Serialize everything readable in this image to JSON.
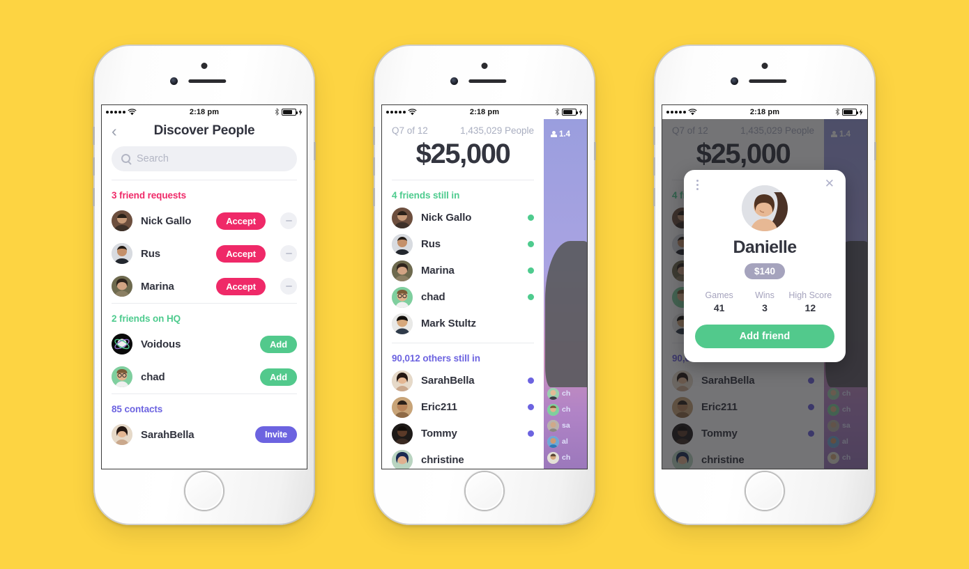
{
  "background_color": "#FDD442",
  "status_bar": {
    "time": "2:18 pm",
    "carrier_dots": 5
  },
  "colors": {
    "pink": "#ef2968",
    "green": "#4ecb8e",
    "purple": "#6c63e0",
    "text_dark": "#30323d",
    "muted": "#a9aec0"
  },
  "phone1": {
    "nav": {
      "back_icon": "chevron-left-icon",
      "title": "Discover People"
    },
    "search": {
      "placeholder": "Search",
      "value": ""
    },
    "sections": [
      {
        "label": "3 friend requests",
        "color": "pink",
        "rows": [
          {
            "name": "Nick Gallo",
            "action": "Accept",
            "dismiss": true
          },
          {
            "name": "Rus",
            "action": "Accept",
            "dismiss": true
          },
          {
            "name": "Marina",
            "action": "Accept",
            "dismiss": true
          }
        ]
      },
      {
        "label": "2 friends on HQ",
        "color": "green",
        "rows": [
          {
            "name": "Voidous",
            "action": "Add",
            "dismiss": false
          },
          {
            "name": "chad",
            "action": "Add",
            "dismiss": false
          }
        ]
      },
      {
        "label": "85 contacts",
        "color": "purple",
        "rows": [
          {
            "name": "SarahBella",
            "action": "Invite",
            "dismiss": false
          }
        ]
      }
    ]
  },
  "phone2": {
    "header": {
      "question": "Q7 of 12",
      "people": "1,435,029 People"
    },
    "prize": "$25,000",
    "sections": [
      {
        "label": "4 friends still in",
        "color": "green",
        "rows": [
          {
            "name": "Nick Gallo",
            "dot": "green"
          },
          {
            "name": "Rus",
            "dot": "green"
          },
          {
            "name": "Marina",
            "dot": "green"
          },
          {
            "name": "chad",
            "dot": "green"
          },
          {
            "name": "Mark Stultz",
            "dot": "none"
          }
        ]
      },
      {
        "label": "90,012 others still in",
        "color": "purple",
        "rows": [
          {
            "name": "SarahBella",
            "dot": "purple"
          },
          {
            "name": "Eric211",
            "dot": "purple"
          },
          {
            "name": "Tommy",
            "dot": "purple"
          },
          {
            "name": "christine",
            "dot": "none"
          }
        ]
      }
    ],
    "live_strip": {
      "viewer_count": "1.4",
      "viewer_icon": "person-icon",
      "chat": [
        {
          "user": "ch"
        },
        {
          "user": "ch"
        },
        {
          "user": "sa"
        },
        {
          "user": "al"
        },
        {
          "user": "ch"
        }
      ]
    }
  },
  "phone3": {
    "profile_card": {
      "menu_icon": "kebab-menu-icon",
      "close_icon": "close-icon",
      "avatar_icon": "avatar",
      "name": "Danielle",
      "money": "$140",
      "stats": [
        {
          "key": "Games",
          "value": "41"
        },
        {
          "key": "Wins",
          "value": "3"
        },
        {
          "key": "High Score",
          "value": "12"
        }
      ],
      "add_friend_label": "Add friend"
    }
  }
}
